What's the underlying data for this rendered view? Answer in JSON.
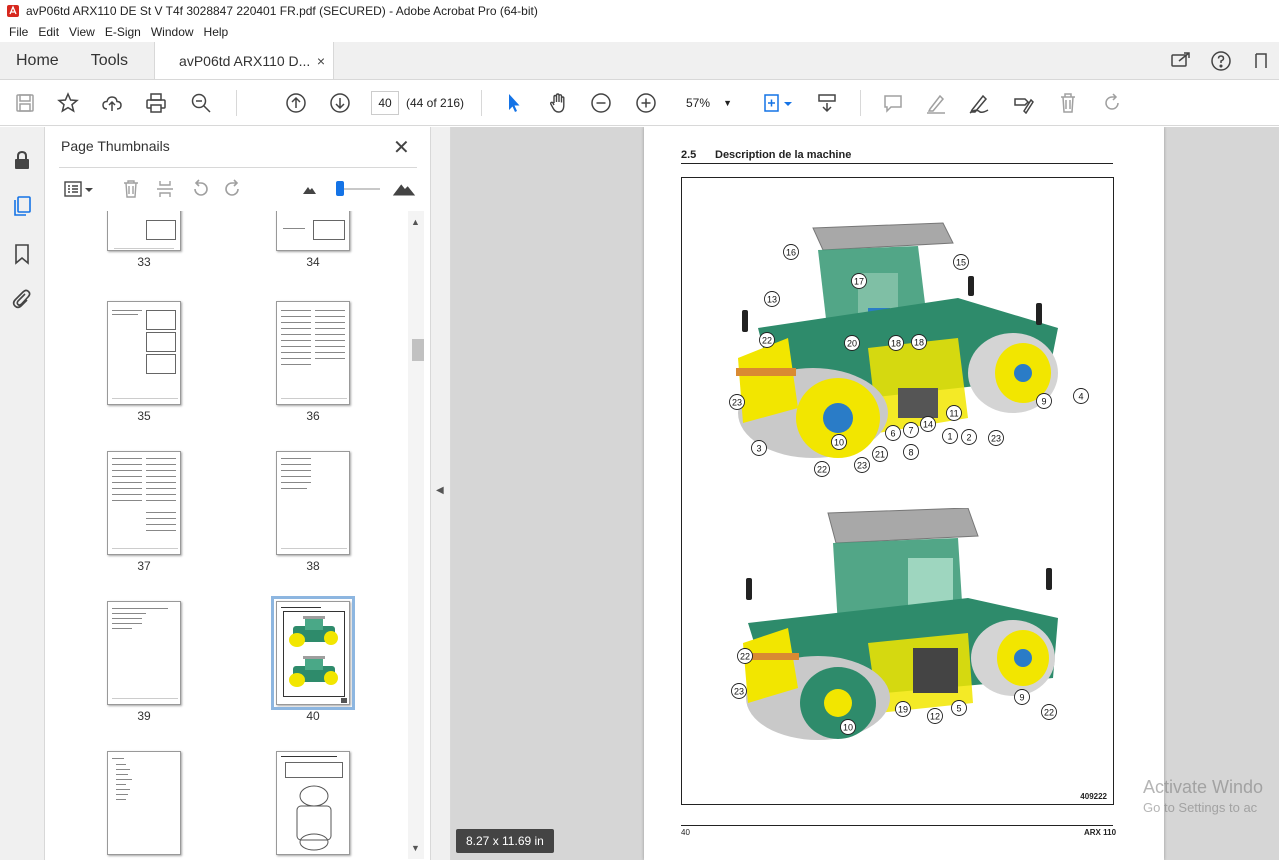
{
  "window": {
    "title": "avP06td ARX110 DE St V T4f 3028847 220401 FR.pdf (SECURED) - Adobe Acrobat Pro (64-bit)"
  },
  "menu": [
    "File",
    "Edit",
    "View",
    "E-Sign",
    "Window",
    "Help"
  ],
  "tabs": {
    "home": "Home",
    "tools": "Tools",
    "document": "avP06td ARX110 D...",
    "close": "×"
  },
  "toolbar": {
    "page_number": "40",
    "page_count": "(44 of 216)",
    "zoom": "57%",
    "zoom_caret": "▼"
  },
  "panel": {
    "title": "Page Thumbnails",
    "close": "✕",
    "thumbnails": [
      {
        "label": "33"
      },
      {
        "label": "34"
      },
      {
        "label": "35"
      },
      {
        "label": "36"
      },
      {
        "label": "37"
      },
      {
        "label": "38"
      },
      {
        "label": "39"
      },
      {
        "label": "40",
        "selected": true
      },
      {
        "label": ""
      },
      {
        "label": ""
      }
    ]
  },
  "document": {
    "section_number": "2.5",
    "section_title": "Description de la machine",
    "figure_id": "409222",
    "footer_page": "40",
    "footer_model": "ARX 110",
    "upper_callouts": [
      "16",
      "15",
      "17",
      "13",
      "22",
      "18",
      "18",
      "20",
      "4",
      "9",
      "23",
      "11",
      "2",
      "23",
      "14",
      "1",
      "6",
      "7",
      "3",
      "10",
      "8",
      "21",
      "23",
      "22"
    ],
    "lower_callouts": [
      "22",
      "23",
      "9",
      "22",
      "19",
      "5",
      "12",
      "10"
    ]
  },
  "status": {
    "page_size": "8.27 x 11.69 in"
  },
  "watermark": {
    "line1": "Activate Windo",
    "line2": "Go to Settings to ac"
  },
  "colors": {
    "accent": "#1473e6",
    "machine_body": "#2e8b6b",
    "machine_highlight": "#f2e600",
    "cab_roof": "#9e9e9e"
  }
}
